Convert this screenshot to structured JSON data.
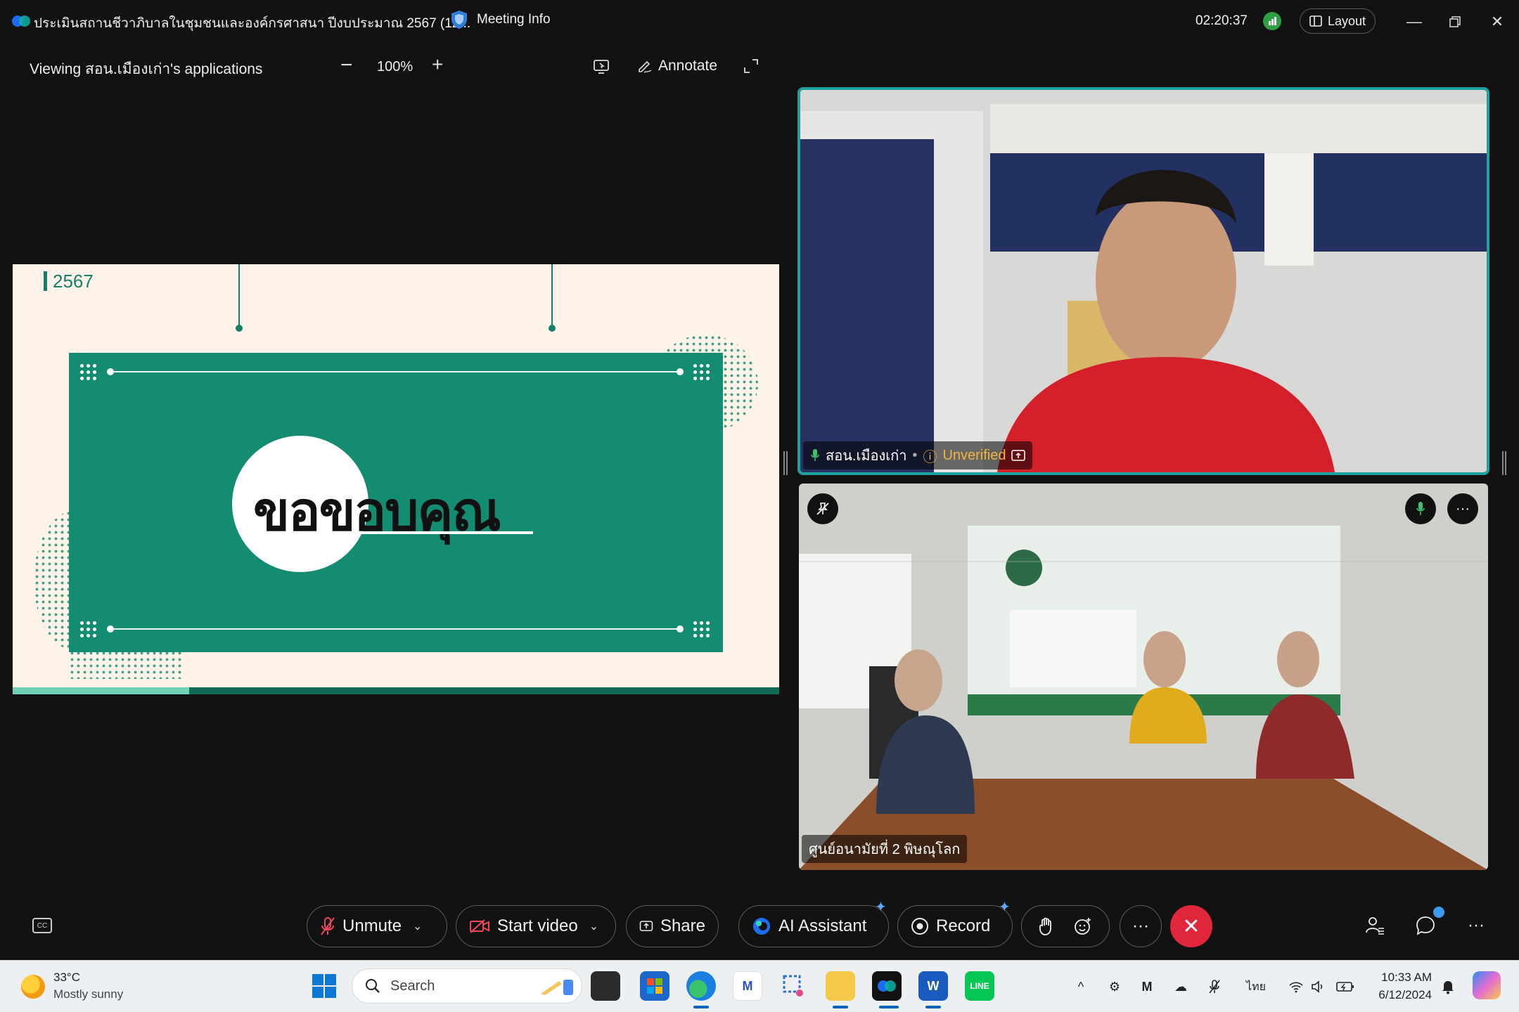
{
  "window": {
    "title": "ประเมินสถานชีวาภิบาลในชุมชนและองค์กรศาสนา ปีงบประมาณ 2567 (12...",
    "meeting_info": "Meeting Info",
    "clock": "02:20:37",
    "layout": "Layout"
  },
  "share_bar": {
    "viewing": "Viewing สอน.เมืองเก่า's applications",
    "zoom": "100%",
    "annotate": "Annotate"
  },
  "slide": {
    "year": "2567",
    "thanks": "ขอขอบคุณ",
    "progress": 0.23
  },
  "participants": [
    {
      "name": "สอน.เมืองเก่า",
      "status": "Unverified"
    },
    {
      "name": "ศูนย์อนามัยที่ 2 พิษณุโลก"
    }
  ],
  "controls": {
    "unmute": "Unmute",
    "start_video": "Start video",
    "share": "Share",
    "ai_assistant": "AI Assistant",
    "record": "Record",
    "more": "···",
    "end": "✕"
  },
  "taskbar": {
    "temperature": "33°C",
    "condition": "Mostly sunny",
    "search_placeholder": "Search",
    "language": "ไทย",
    "time": "10:33 AM",
    "date": "6/12/2024"
  },
  "colors": {
    "slide_green": "#148c72",
    "slide_bg": "#fdf3e8",
    "active_speaker_border": "#21a0a0",
    "end_call": "#e0263a",
    "unverified": "#f0b33e"
  }
}
